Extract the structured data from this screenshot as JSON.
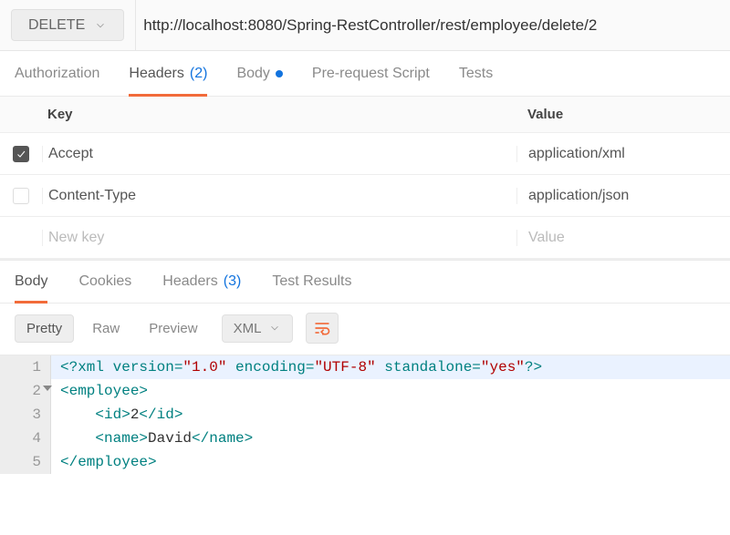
{
  "request": {
    "method": "DELETE",
    "url": "http://localhost:8080/Spring-RestController/rest/employee/delete/2"
  },
  "req_tabs": {
    "authorization": "Authorization",
    "headers": {
      "label": "Headers",
      "count": "(2)"
    },
    "body": "Body",
    "prerequest": "Pre-request Script",
    "tests": "Tests",
    "active": "headers"
  },
  "headers_table": {
    "head_key": "Key",
    "head_value": "Value",
    "rows": [
      {
        "enabled": true,
        "key": "Accept",
        "value": "application/xml"
      },
      {
        "enabled": false,
        "key": "Content-Type",
        "value": "application/json"
      }
    ],
    "placeholder_key": "New key",
    "placeholder_value": "Value"
  },
  "resp_tabs": {
    "body": "Body",
    "cookies": "Cookies",
    "headers": {
      "label": "Headers",
      "count": "(3)"
    },
    "tests": "Test Results",
    "active": "body"
  },
  "resp_toolbar": {
    "pretty": "Pretty",
    "raw": "Raw",
    "preview": "Preview",
    "format": "XML"
  },
  "response_body": {
    "line1_a": "<?xml ",
    "line1_b": "version=",
    "line1_c": "\"1.0\"",
    "line1_d": " encoding=",
    "line1_e": "\"UTF-8\"",
    "line1_f": " standalone=",
    "line1_g": "\"yes\"",
    "line1_h": "?>",
    "line2": "<employee>",
    "line3_open": "<id>",
    "line3_text": "2",
    "line3_close": "</id>",
    "line4_open": "<name>",
    "line4_text": "David",
    "line4_close": "</name>",
    "line5": "</employee>"
  }
}
